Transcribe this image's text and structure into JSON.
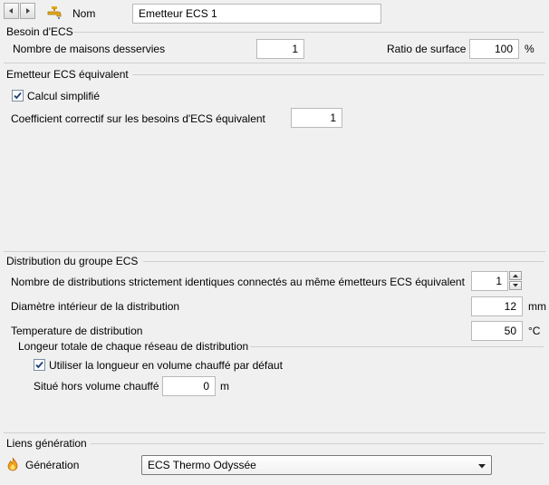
{
  "header": {
    "name_label": "Nom",
    "name_value": "Emetteur ECS 1"
  },
  "besoin": {
    "title": "Besoin d'ECS",
    "nb_maisons_label": "Nombre de maisons desservies",
    "nb_maisons_value": "1",
    "ratio_label": "Ratio de surface",
    "ratio_value": "100",
    "ratio_unit": "%"
  },
  "emetteur": {
    "title": "Emetteur ECS équivalent",
    "calcul_label": "Calcul simplifié",
    "calcul_checked": true,
    "coef_label": "Coefficient correctif sur les besoins d'ECS équivalent",
    "coef_value": "1"
  },
  "distribution": {
    "title": "Distribution du groupe ECS",
    "nb_distrib_label": "Nombre de distributions strictement identiques connectés au même émetteurs ECS équivalent",
    "nb_distrib_value": "1",
    "diametre_label": "Diamètre intérieur de la distribution",
    "diametre_value": "12",
    "diametre_unit": "mm",
    "temp_label": "Temperature de distribution",
    "temp_value": "50",
    "temp_unit": "°C",
    "longueur_title": "Longeur totale de chaque réseau de distribution",
    "utiliser_label": "Utiliser la longueur en volume chauffé par défaut",
    "utiliser_checked": true,
    "hors_label": "Situé hors volume chauffé",
    "hors_value": "0",
    "hors_unit": "m"
  },
  "liens": {
    "title": "Liens génération",
    "generation_label": "Génération",
    "generation_value": "ECS Thermo Odyssée"
  },
  "icons": {
    "prev": "arrow-left-icon",
    "next": "arrow-right-icon",
    "tap": "faucet-icon",
    "generation": "flame-icon",
    "dropdown": "chevron-down-icon",
    "spin_up": "spin-up-icon",
    "spin_down": "spin-down-icon"
  },
  "colors": {
    "background": "#f0f0f0",
    "field_border": "#b9b9b9",
    "checkbox_border": "#7a8ea3",
    "tap_icon": "#e3a91c"
  }
}
